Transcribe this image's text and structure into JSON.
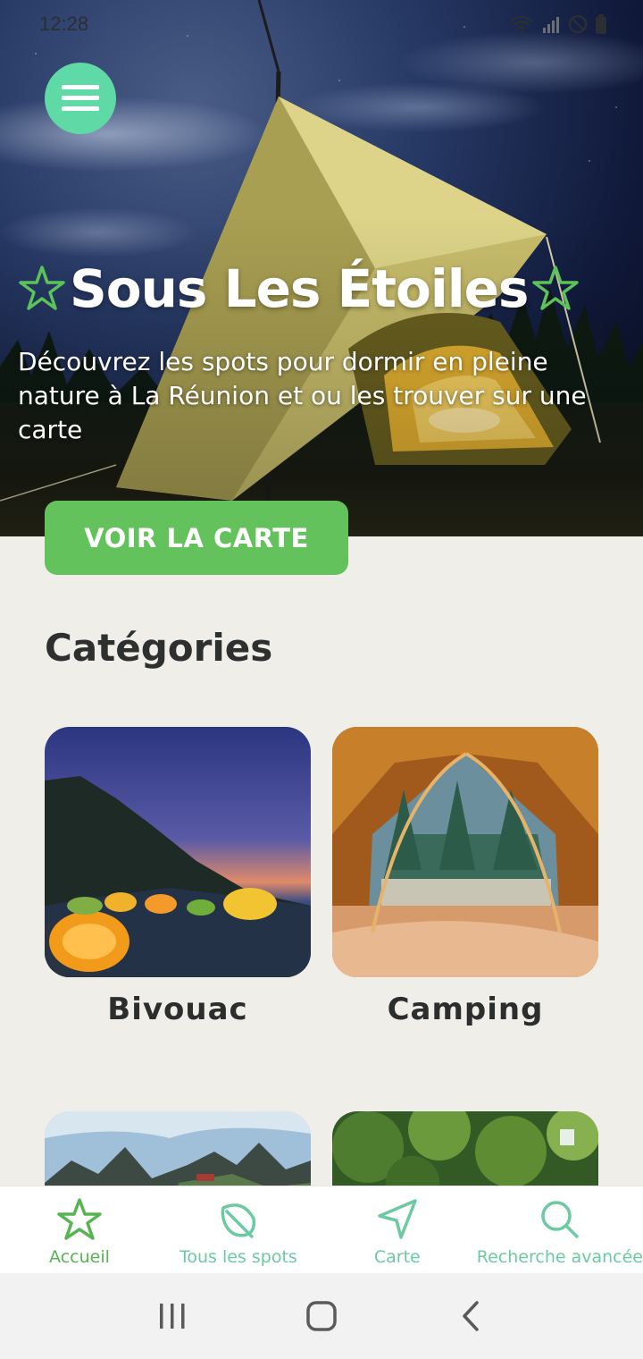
{
  "status_bar": {
    "time": "12:28"
  },
  "hero": {
    "title": "Sous Les Étoiles",
    "subtitle": "Découvrez les spots pour dormir en pleine nature à La Réunion et ou les trouver sur une carte",
    "cta_label": "VOIR LA CARTE"
  },
  "categories": {
    "heading": "Catégories",
    "items": [
      {
        "label": "Bivouac"
      },
      {
        "label": "Camping"
      },
      {
        "label": ""
      },
      {
        "label": ""
      }
    ]
  },
  "bottom_nav": {
    "items": [
      {
        "label": "Accueil",
        "icon": "star-icon",
        "active": true
      },
      {
        "label": "Tous les spots",
        "icon": "leaf-icon",
        "active": false
      },
      {
        "label": "Carte",
        "icon": "navigation-arrow-icon",
        "active": false
      },
      {
        "label": "Recherche avancée",
        "icon": "search-icon",
        "active": false
      }
    ]
  },
  "colors": {
    "accent_green": "#63c25b",
    "menu_teal": "#5fd9a5",
    "nav_teal": "#6ccaa3",
    "background": "#efeee9"
  }
}
